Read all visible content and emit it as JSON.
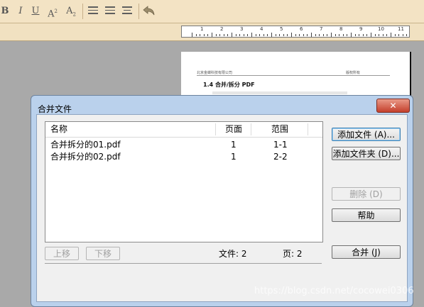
{
  "toolbar": {
    "bold": "B",
    "italic": "I",
    "underline": "U",
    "superscript": "A",
    "superscript_mark": "2",
    "subscript": "A",
    "subscript_mark": "2"
  },
  "ruler": {
    "labels": [
      "1",
      "2",
      "3",
      "4",
      "5",
      "6",
      "7",
      "8",
      "9",
      "10",
      "11"
    ]
  },
  "doc": {
    "header_left": "北京金蝶科技有限公司",
    "header_right": "版权所有",
    "section": "1.4 合并/拆分 PDF"
  },
  "dialog": {
    "title": "合并文件",
    "close": "✕",
    "columns": {
      "name": "名称",
      "pages": "页面",
      "range": "范围"
    },
    "files": [
      {
        "name": "合并拆分的01.pdf",
        "pages": "1",
        "range": "1-1"
      },
      {
        "name": "合并拆分的02.pdf",
        "pages": "1",
        "range": "2-2"
      }
    ],
    "buttons": {
      "add_file": "添加文件 (A)...",
      "add_folder": "添加文件夹 (D)...",
      "delete": "删除 (D)",
      "help": "帮助",
      "move_up": "上移",
      "move_down": "下移",
      "merge": "合并 (J)"
    },
    "file_count": "文件: 2",
    "page_count": "页: 2"
  },
  "watermark": "https://blog.csdn.net/cocowei0306"
}
